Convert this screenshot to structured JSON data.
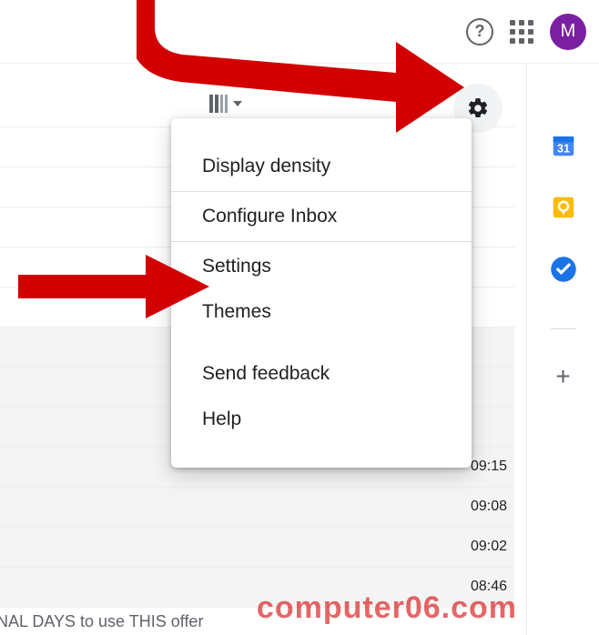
{
  "header": {
    "avatar_initial": "M"
  },
  "menu": {
    "items": [
      "Display density",
      "Configure Inbox",
      "Settings",
      "Themes",
      "Send feedback",
      "Help"
    ]
  },
  "times": {
    "t0": "09:15",
    "t1": "09:08",
    "t2": "09:02",
    "t3": "08:46"
  },
  "partial_row": "NAL DAYS to use THIS offer",
  "watermark": "computer06.com"
}
